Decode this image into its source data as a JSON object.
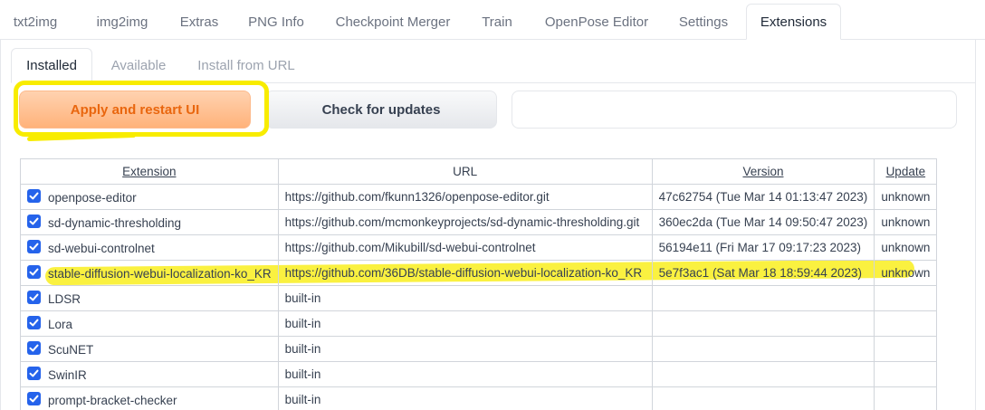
{
  "top_tabs": [
    "txt2img",
    "img2img",
    "Extras",
    "PNG Info",
    "Checkpoint Merger",
    "Train",
    "OpenPose Editor",
    "Settings",
    "Extensions"
  ],
  "active_top_tab": "Extensions",
  "sub_tabs": [
    "Installed",
    "Available",
    "Install from URL"
  ],
  "active_sub_tab": "Installed",
  "buttons": {
    "apply": "Apply and restart UI",
    "check": "Check for updates"
  },
  "status_box": "",
  "table": {
    "headers": {
      "extension": "Extension",
      "url": "URL",
      "version": "Version",
      "update": "Update"
    },
    "rows": [
      {
        "name": "openpose-editor",
        "checked": true,
        "url": "https://github.com/fkunn1326/openpose-editor.git",
        "version": "47c62754 (Tue Mar 14 01:13:47 2023)",
        "update": "unknown"
      },
      {
        "name": "sd-dynamic-thresholding",
        "checked": true,
        "url": "https://github.com/mcmonkeyprojects/sd-dynamic-thresholding.git",
        "version": "360ec2da (Tue Mar 14 09:50:47 2023)",
        "update": "unknown"
      },
      {
        "name": "sd-webui-controlnet",
        "checked": true,
        "url": "https://github.com/Mikubill/sd-webui-controlnet",
        "version": "56194e11 (Fri Mar 17 09:17:23 2023)",
        "update": "unknown"
      },
      {
        "name": "stable-diffusion-webui-localization-ko_KR",
        "checked": true,
        "url": "https://github.com/36DB/stable-diffusion-webui-localization-ko_KR",
        "version": "5e7f3ac1 (Sat Mar 18 18:59:44 2023)",
        "update": "unknown"
      },
      {
        "name": "LDSR",
        "checked": true,
        "url": "built-in",
        "version": "",
        "update": ""
      },
      {
        "name": "Lora",
        "checked": true,
        "url": "built-in",
        "version": "",
        "update": ""
      },
      {
        "name": "ScuNET",
        "checked": true,
        "url": "built-in",
        "version": "",
        "update": ""
      },
      {
        "name": "SwinIR",
        "checked": true,
        "url": "built-in",
        "version": "",
        "update": ""
      },
      {
        "name": "prompt-bracket-checker",
        "checked": true,
        "url": "built-in",
        "version": "",
        "update": ""
      }
    ]
  },
  "colors": {
    "accent_orange": "#e9660e",
    "checkbox_blue": "#2563eb",
    "highlight_yellow": "#f8ec00"
  }
}
